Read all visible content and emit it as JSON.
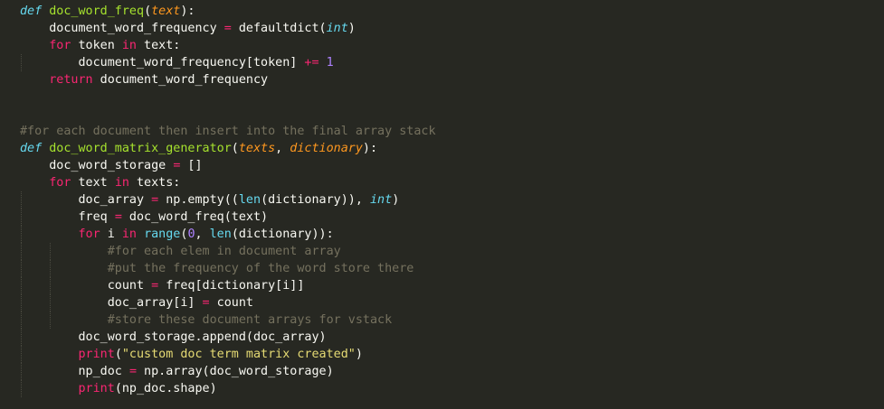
{
  "editor": {
    "theme_colors": {
      "background": "#272822",
      "text": "#f8f8f2",
      "keyword": "#f92672",
      "function": "#a6e22e",
      "storage": "#66d9ef",
      "parameter": "#fd971f",
      "number": "#ae81ff",
      "string": "#e6db74",
      "comment": "#75715e"
    },
    "lines": [
      [
        [
          "def",
          "def"
        ],
        [
          "t",
          " "
        ],
        [
          "fn",
          "doc_word_freq"
        ],
        [
          "t",
          "("
        ],
        [
          "param",
          "text"
        ],
        [
          "t",
          "):"
        ]
      ],
      [
        [
          "t",
          "    document_word_frequency "
        ],
        [
          "op",
          "="
        ],
        [
          "t",
          " defaultdict("
        ],
        [
          "type",
          "int"
        ],
        [
          "t",
          ")"
        ]
      ],
      [
        [
          "t",
          "    "
        ],
        [
          "kw",
          "for"
        ],
        [
          "t",
          " token "
        ],
        [
          "kw",
          "in"
        ],
        [
          "t",
          " text:"
        ]
      ],
      [
        [
          "t",
          "        document_word_frequency[token] "
        ],
        [
          "op",
          "+="
        ],
        [
          "t",
          " "
        ],
        [
          "num",
          "1"
        ]
      ],
      [
        [
          "t",
          "    "
        ],
        [
          "kw",
          "return"
        ],
        [
          "t",
          " document_word_frequency"
        ]
      ],
      [],
      [],
      [
        [
          "com",
          "#for each document then insert into the final array stack"
        ]
      ],
      [
        [
          "def",
          "def"
        ],
        [
          "t",
          " "
        ],
        [
          "fn",
          "doc_word_matrix_generator"
        ],
        [
          "t",
          "("
        ],
        [
          "param",
          "texts"
        ],
        [
          "t",
          ", "
        ],
        [
          "param",
          "dictionary"
        ],
        [
          "t",
          "):"
        ]
      ],
      [
        [
          "t",
          "    doc_word_storage "
        ],
        [
          "op",
          "="
        ],
        [
          "t",
          " []"
        ]
      ],
      [
        [
          "t",
          "    "
        ],
        [
          "kw",
          "for"
        ],
        [
          "t",
          " text "
        ],
        [
          "kw",
          "in"
        ],
        [
          "t",
          " texts:"
        ]
      ],
      [
        [
          "t",
          "        doc_array "
        ],
        [
          "op",
          "="
        ],
        [
          "t",
          " np.empty(("
        ],
        [
          "builtin",
          "len"
        ],
        [
          "t",
          "(dictionary)), "
        ],
        [
          "type",
          "int"
        ],
        [
          "t",
          ")"
        ]
      ],
      [
        [
          "t",
          "        freq "
        ],
        [
          "op",
          "="
        ],
        [
          "t",
          " doc_word_freq(text)"
        ]
      ],
      [
        [
          "t",
          "        "
        ],
        [
          "kw",
          "for"
        ],
        [
          "t",
          " i "
        ],
        [
          "kw",
          "in"
        ],
        [
          "t",
          " "
        ],
        [
          "builtin",
          "range"
        ],
        [
          "t",
          "("
        ],
        [
          "num",
          "0"
        ],
        [
          "t",
          ", "
        ],
        [
          "builtin",
          "len"
        ],
        [
          "t",
          "(dictionary)):"
        ]
      ],
      [
        [
          "t",
          "            "
        ],
        [
          "com",
          "#for each elem in document array"
        ]
      ],
      [
        [
          "t",
          "            "
        ],
        [
          "com",
          "#put the frequency of the word store there"
        ]
      ],
      [
        [
          "t",
          "            count "
        ],
        [
          "op",
          "="
        ],
        [
          "t",
          " freq[dictionary[i]]"
        ]
      ],
      [
        [
          "t",
          "            doc_array[i] "
        ],
        [
          "op",
          "="
        ],
        [
          "t",
          " count"
        ]
      ],
      [
        [
          "t",
          "            "
        ],
        [
          "com",
          "#store these document arrays for vstack"
        ]
      ],
      [
        [
          "t",
          "        doc_word_storage.append(doc_array)"
        ]
      ],
      [
        [
          "t",
          "        "
        ],
        [
          "kw",
          "print"
        ],
        [
          "t",
          "("
        ],
        [
          "str",
          "\"custom doc term matrix created\""
        ],
        [
          "t",
          ")"
        ]
      ],
      [
        [
          "t",
          "        np_doc "
        ],
        [
          "op",
          "="
        ],
        [
          "t",
          " np.array(doc_word_storage)"
        ]
      ],
      [
        [
          "t",
          "        "
        ],
        [
          "kw",
          "print"
        ],
        [
          "t",
          "(np_doc.shape)"
        ]
      ]
    ]
  }
}
